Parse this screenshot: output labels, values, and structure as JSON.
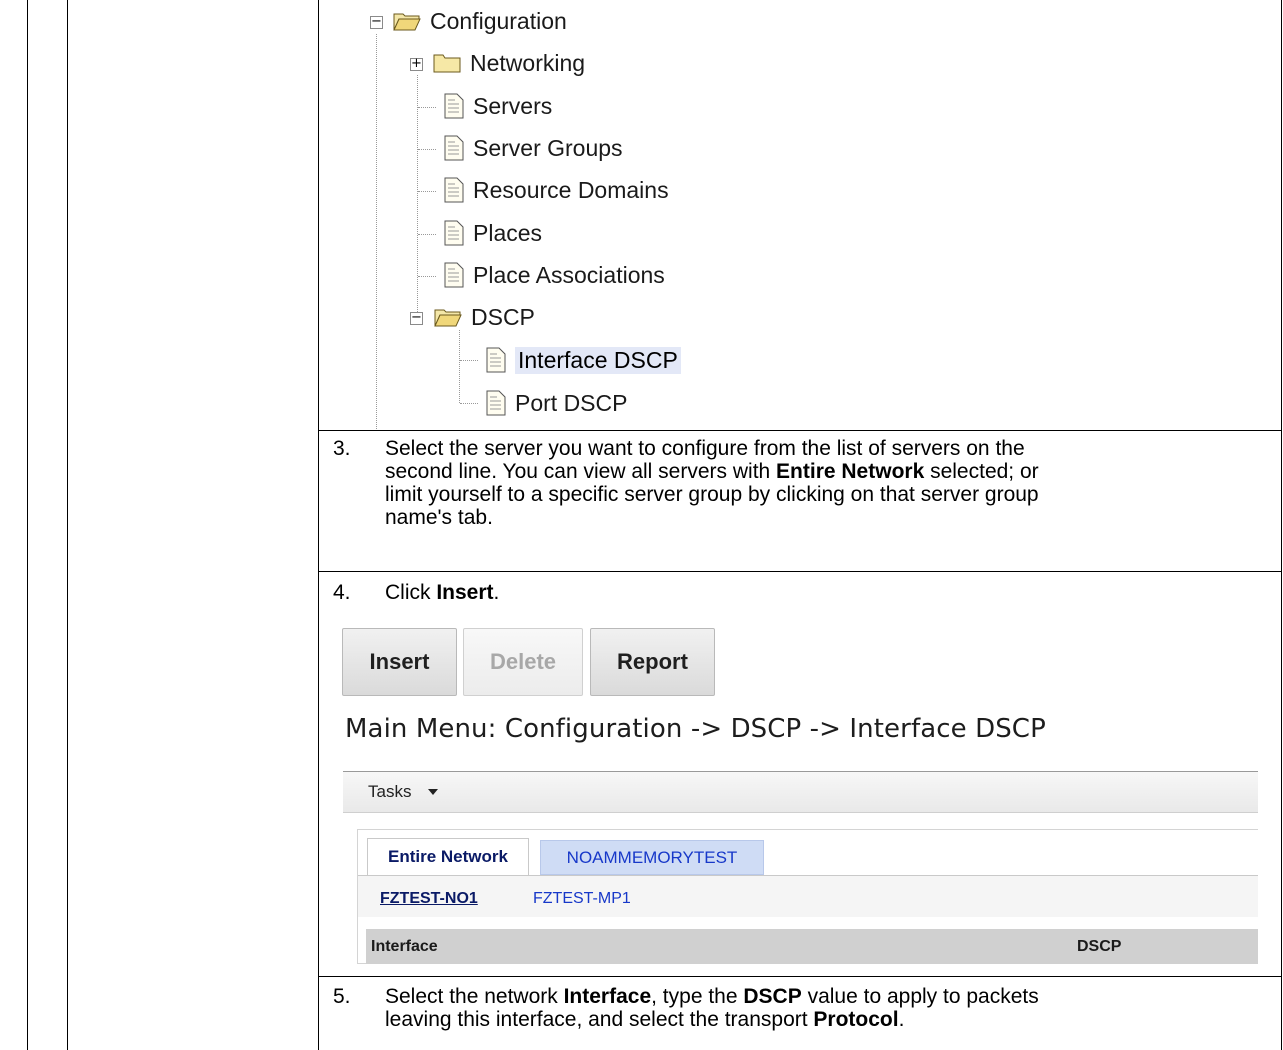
{
  "tree": {
    "configuration": "Configuration",
    "networking": "Networking",
    "servers": "Servers",
    "server_groups": "Server Groups",
    "resource_domains": "Resource Domains",
    "places": "Places",
    "place_associations": "Place Associations",
    "dscp": "DSCP",
    "interface_dscp": "Interface DSCP",
    "port_dscp": "Port DSCP"
  },
  "steps": {
    "s3_num": "3.",
    "s3_line1": "Select the server you want to configure from the list of servers on the",
    "s3_line2a": "second line.  You can view all servers with ",
    "s3_line2b": "Entire Network",
    "s3_line2c": " selected; or",
    "s3_line3": "limit yourself to a specific server group by clicking on that server group",
    "s3_line4": "name's tab.",
    "s4_num": "4.",
    "s4_a": "Click ",
    "s4_b": "Insert",
    "s4_c": ".",
    "s5_num": "5.",
    "s5_1a": "Select the network ",
    "s5_1b": "Interface",
    "s5_1c": ", type the ",
    "s5_1d": "DSCP",
    "s5_1e": " value to apply to packets",
    "s5_2a": "leaving this interface, and select the transport ",
    "s5_2b": "Protocol",
    "s5_2c": "."
  },
  "buttons": {
    "insert": "Insert",
    "delete": "Delete",
    "report": "Report"
  },
  "breadcrumb": "Main Menu: Configuration -> DSCP -> Interface DSCP",
  "tasks": "Tasks",
  "tabs": {
    "entire_network": "Entire Network",
    "group": "NOAMMEMORYTEST"
  },
  "servers": {
    "first": "FZTEST-NO1",
    "second": "FZTEST-MP1"
  },
  "table": {
    "col_interface": "Interface",
    "col_dscp": "DSCP"
  },
  "colors": {
    "selection_highlight": "#e3e8f7",
    "tab_active_text": "#0a1a66",
    "tab_inactive_bg": "#cfdcf5",
    "link_blue": "#1738c9"
  }
}
